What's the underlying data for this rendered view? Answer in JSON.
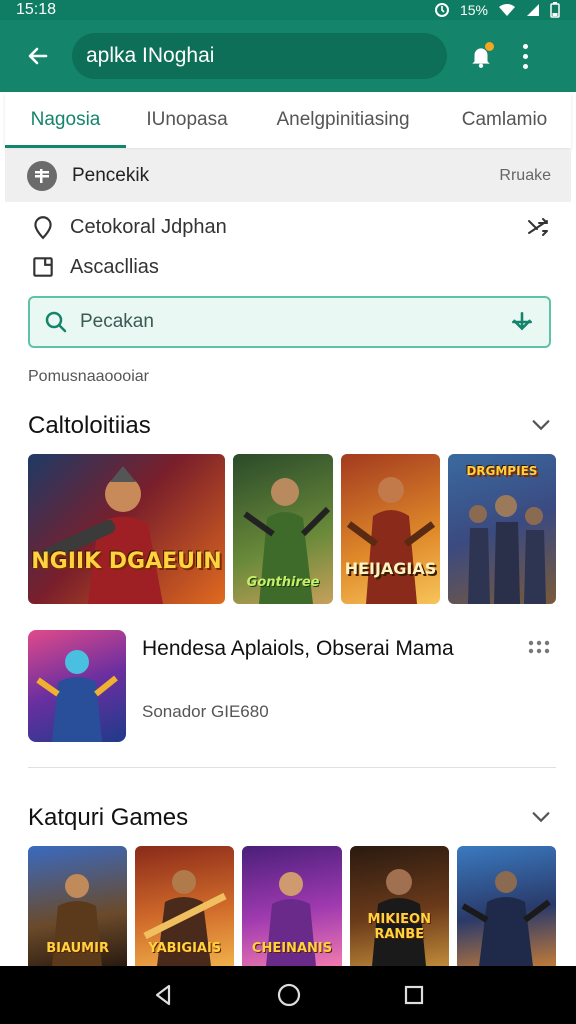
{
  "status": {
    "time": "15:18",
    "battery": "15%"
  },
  "appbar": {
    "search_text": "aplka INoghai"
  },
  "tabs": [
    {
      "label": "Nagosia"
    },
    {
      "label": "IUnopasa"
    },
    {
      "label": "Anelgpinitiasing"
    },
    {
      "label": "Camlamio"
    }
  ],
  "filter": {
    "label": "Pencekik",
    "right": "Rruake"
  },
  "rows": [
    {
      "label": "Cetokoral Jdphan",
      "icon": "location-icon"
    },
    {
      "label": "Ascacllias",
      "icon": "calendar-icon"
    }
  ],
  "search": {
    "placeholder": "Pecakan"
  },
  "caption": "Pomusnaaoooiar",
  "section1": {
    "title": "Caltoloitiias"
  },
  "banner": [
    {
      "title": "NGIIK DGAEUIN",
      "icon": "game-art-icon"
    },
    {
      "title": "Gonthiree",
      "icon": "game-art-icon"
    },
    {
      "title": "HEIJAGIAS",
      "icon": "game-art-icon"
    },
    {
      "title": "DRGMPIES",
      "icon": "game-art-icon"
    }
  ],
  "app": {
    "title": "Hendesa Aplaiols, Obserai Mama",
    "subtitle": "Sonador GIE680"
  },
  "section2": {
    "title": "Katquri Games"
  },
  "cards": [
    {
      "title": "BIAUMIR"
    },
    {
      "title": "YABIGIAIS"
    },
    {
      "title": "CHEINANIS"
    },
    {
      "title": "MIKIEON RANBE"
    },
    {
      "title": ""
    }
  ],
  "colors": {
    "primary": "#14856b",
    "accent": "#f5a623"
  }
}
